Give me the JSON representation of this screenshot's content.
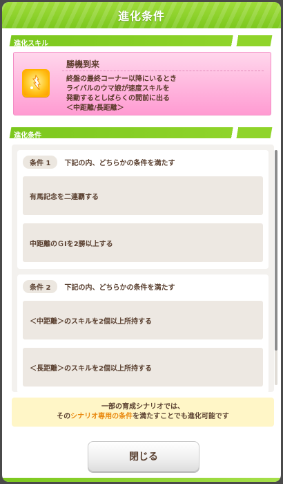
{
  "header": {
    "title": "進化条件"
  },
  "sections": {
    "skill_label": "進化スキル",
    "conditions_label": "進化条件"
  },
  "skill": {
    "name": "勝機到来",
    "icon": "running-speed-icon",
    "desc_lines": [
      "終盤の最終コーナー以降にいるとき",
      "ライバルのウマ娘が速度スキルを",
      "発動するとしばらくの間前に出る",
      "＜中距離/長距離＞"
    ]
  },
  "conditions": [
    {
      "badge": "条件 1",
      "instruction": "下記の内、どちらかの条件を満たす",
      "items": [
        "有馬記念を二連覇する",
        "中距離のＧⅠを2勝以上する"
      ]
    },
    {
      "badge": "条件 2",
      "instruction": "下記の内、どちらかの条件を満たす",
      "items": [
        "＜中距離＞のスキルを2個以上所持する",
        "＜長距離＞のスキルを2個以上所持する"
      ]
    }
  ],
  "note": {
    "line1": "一部の育成シナリオでは、",
    "line2_pre": "その",
    "line2_hl1": "シナリオ専用の条件",
    "line2_post": "を満たすことでも進化可能です"
  },
  "close_label": "閉じる",
  "colors": {
    "accent_green": "#7cc81e",
    "skill_pink": "#ff9bd2",
    "note_highlight": "#e98a12"
  }
}
